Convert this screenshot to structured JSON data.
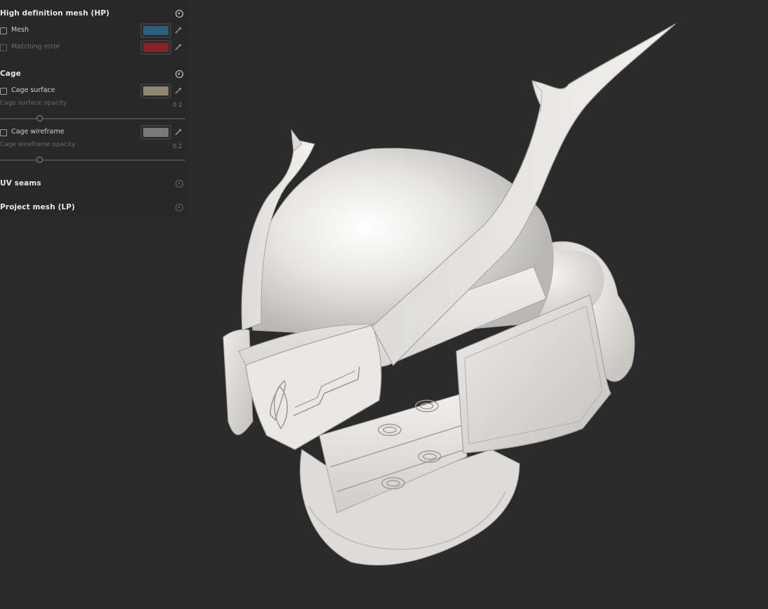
{
  "colors": {
    "background": "#2b2b2b",
    "panel": "#282828",
    "mesh_swatch": "#2d5e80",
    "matching_error_swatch": "#8a2028",
    "cage_surface_swatch": "#8e8770",
    "cage_wireframe_swatch": "#7a7a7a"
  },
  "panel": {
    "hp_section": {
      "title": "High definition mesh (HP)",
      "mesh_label": "Mesh",
      "matching_error_label": "Matching error"
    },
    "cage_section": {
      "title": "Cage",
      "surface_label": "Cage surface",
      "surface_opacity_label": "Cage surface opacity",
      "surface_opacity_value": "0.2",
      "wireframe_label": "Cage wireframe",
      "wireframe_opacity_label": "Cage wireframe opacity",
      "wireframe_opacity_value": "0.2"
    },
    "uv_seams_title": "UV seams",
    "project_mesh_title": "Project mesh (LP)"
  }
}
